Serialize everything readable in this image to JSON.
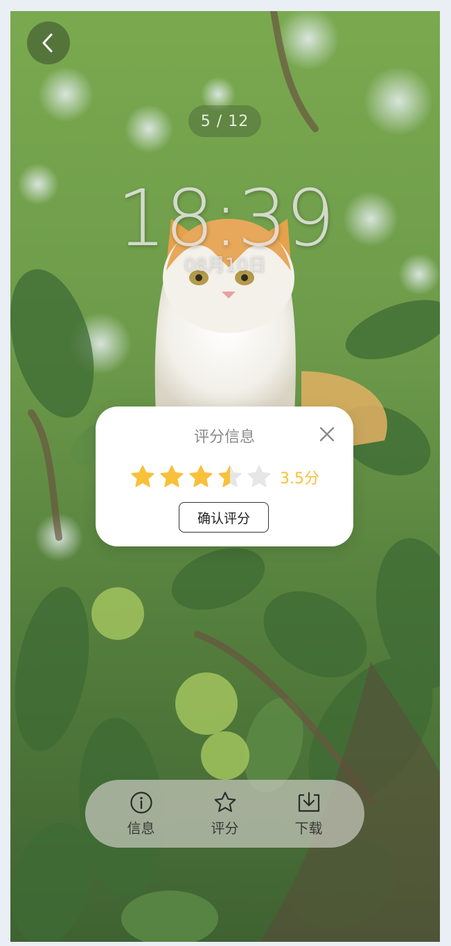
{
  "viewer": {
    "page_indicator": "5 / 12",
    "clock_time": "18:39",
    "clock_date": "08月10日"
  },
  "rating_dialog": {
    "title": "评分信息",
    "rating_value": 3.5,
    "rating_max": 5,
    "score_text": "3.5分",
    "confirm_label": "确认评分",
    "star_color": "#f9c03a",
    "star_empty_color": "#e6e6e6"
  },
  "bottom_bar": {
    "items": [
      {
        "label": "信息",
        "icon": "info-icon"
      },
      {
        "label": "评分",
        "icon": "star-outline-icon"
      },
      {
        "label": "下载",
        "icon": "download-icon"
      }
    ]
  }
}
